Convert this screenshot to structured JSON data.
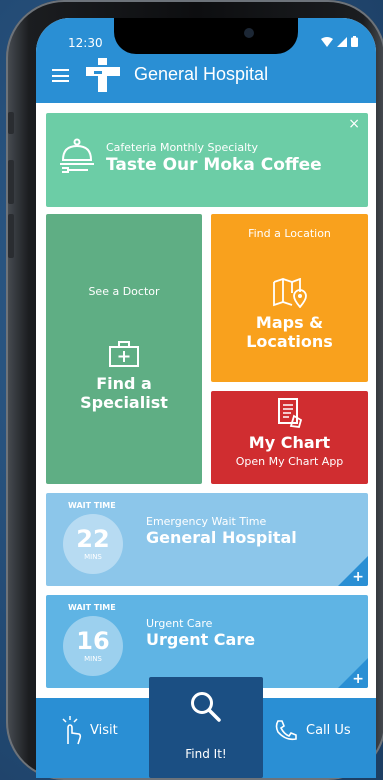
{
  "status_bar": {
    "time": "12:30"
  },
  "header": {
    "title": "General Hospital"
  },
  "promo": {
    "subtitle": "Cafeteria Monthly Specialty",
    "title": "Taste Our Moka Coffee",
    "close": "×"
  },
  "tiles": {
    "doctor": {
      "small": "See a Doctor",
      "title_line1": "Find a",
      "title_line2": "Specialist"
    },
    "maps": {
      "small": "Find a Location",
      "title_line1": "Maps &",
      "title_line2": "Locations"
    },
    "chart": {
      "title": "My Chart",
      "small": "Open My Chart App"
    }
  },
  "wait_times": [
    {
      "label": "WAIT TIME",
      "number": "22",
      "unit": "MINS",
      "subtitle": "Emergency Wait Time",
      "name": "General Hospital"
    },
    {
      "label": "WAIT TIME",
      "number": "16",
      "unit": "MINS",
      "subtitle": "Urgent Care",
      "name": "Urgent Care"
    }
  ],
  "bottom_nav": {
    "visit": "Visit",
    "find": "Find It!",
    "call": "Call Us"
  },
  "colors": {
    "primary": "#2a8fd4",
    "promo": "#6ccda6",
    "doctor": "#5fae84",
    "maps": "#f9a11d",
    "chart": "#d02d30",
    "wait1": "#8cc6ea",
    "wait2": "#5fb4e4",
    "find": "#1b4f83"
  }
}
